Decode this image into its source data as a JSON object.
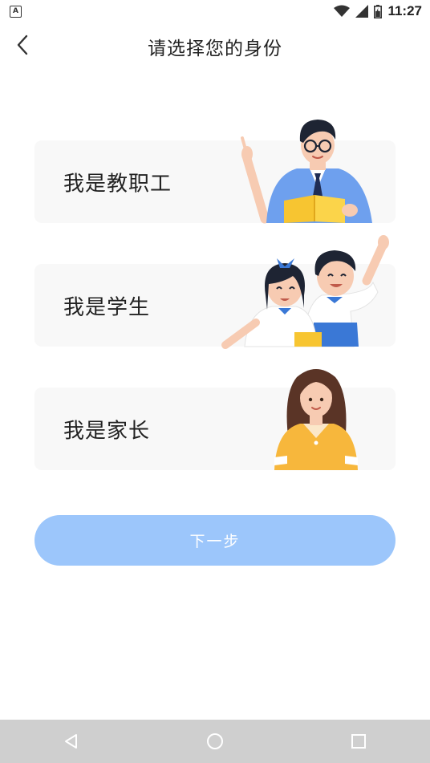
{
  "status_bar": {
    "notification_icon": "a-icon",
    "time": "11:27",
    "icons": [
      "wifi-icon",
      "cellular-signal-icon",
      "battery-icon"
    ]
  },
  "header": {
    "back_icon": "chevron-left-icon",
    "title": "请选择您的身份"
  },
  "roles": [
    {
      "label": "我是教职工",
      "illustration": "teacher-illustration"
    },
    {
      "label": "我是学生",
      "illustration": "students-illustration"
    },
    {
      "label": "我是家长",
      "illustration": "parent-illustration"
    }
  ],
  "next_button": {
    "label": "下一步",
    "color": "#9cc6fb"
  },
  "nav_bar": {
    "buttons": [
      "back-triangle-icon",
      "home-circle-icon",
      "recents-square-icon"
    ]
  },
  "colors": {
    "card_background": "#f8f8f8",
    "accent_blue": "#3a78d6",
    "shirt_orange": "#f7b73c",
    "nav_bar_background": "#cfcfcf"
  }
}
